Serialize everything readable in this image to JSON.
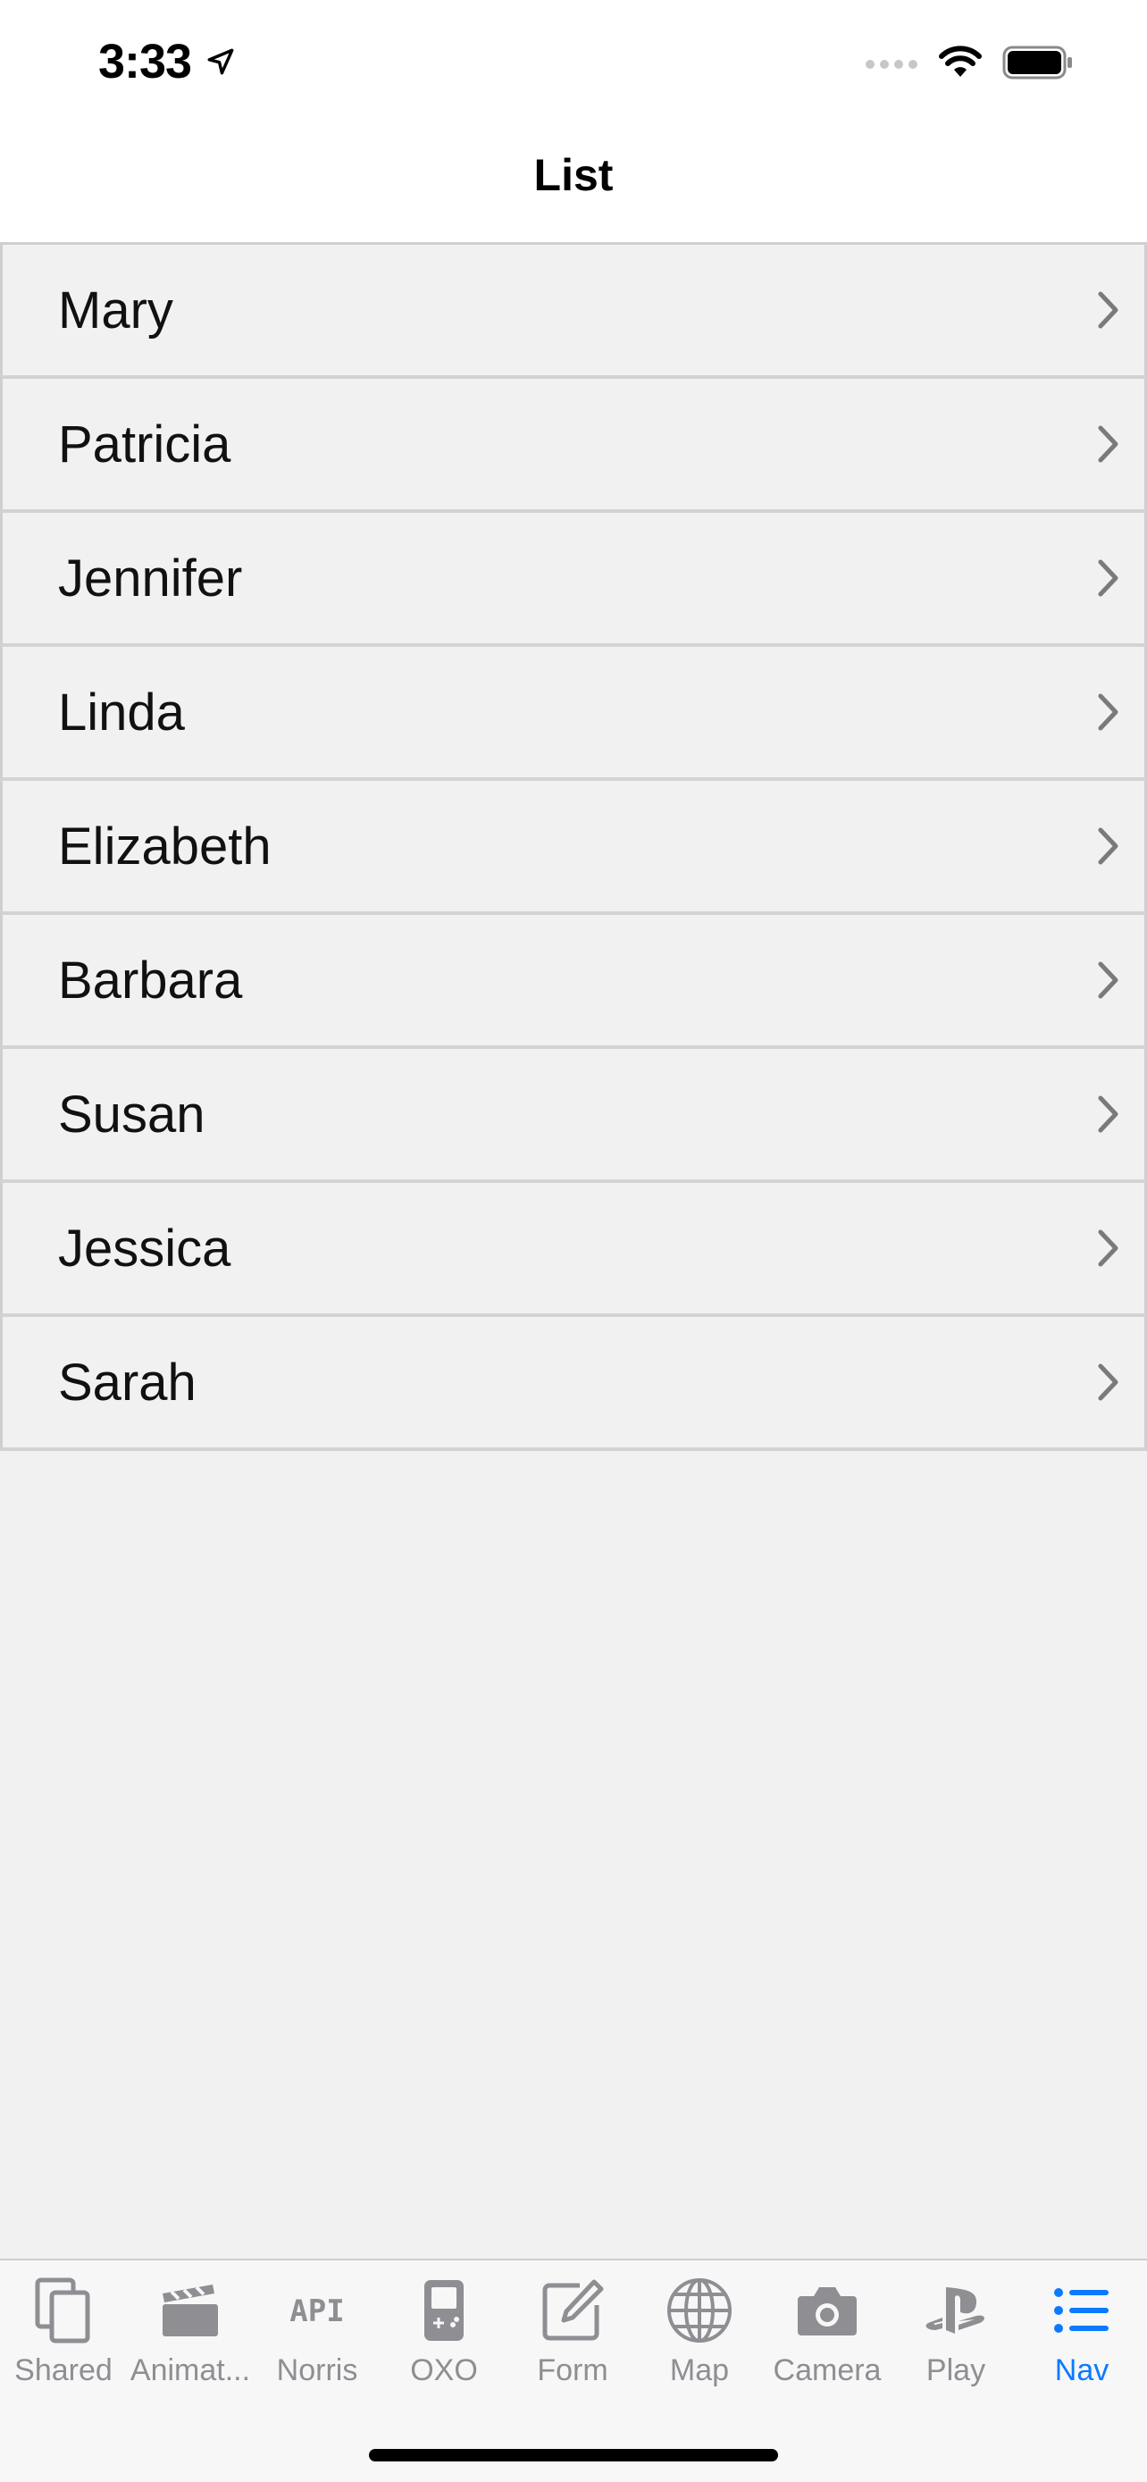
{
  "status_bar": {
    "time": "3:33",
    "icons": [
      "location-arrow-icon",
      "signal-icon",
      "wifi-icon",
      "battery-icon"
    ]
  },
  "nav": {
    "title": "List"
  },
  "list": {
    "items": [
      {
        "label": "Mary"
      },
      {
        "label": "Patricia"
      },
      {
        "label": "Jennifer"
      },
      {
        "label": "Linda"
      },
      {
        "label": "Elizabeth"
      },
      {
        "label": "Barbara"
      },
      {
        "label": "Susan"
      },
      {
        "label": "Jessica"
      },
      {
        "label": "Sarah"
      }
    ],
    "accessory_icon": "chevron-right-icon"
  },
  "tab_bar": {
    "tabs": [
      {
        "label": "Shared",
        "icon": "copy-icon",
        "active": false
      },
      {
        "label": "Animat...",
        "icon": "clapperboard-icon",
        "active": false
      },
      {
        "label": "Norris",
        "icon": "api-icon",
        "active": false
      },
      {
        "label": "OXO",
        "icon": "gameboy-icon",
        "active": false
      },
      {
        "label": "Form",
        "icon": "pencil-square-icon",
        "active": false
      },
      {
        "label": "Map",
        "icon": "globe-icon",
        "active": false
      },
      {
        "label": "Camera",
        "icon": "camera-icon",
        "active": false
      },
      {
        "label": "Play",
        "icon": "playstation-icon",
        "active": false
      },
      {
        "label": "Nav",
        "icon": "list-bullet-icon",
        "active": true
      }
    ]
  },
  "colors": {
    "accent": "#0a7aff",
    "inactive_tab": "#8e8e93",
    "background": "#f1f1f1",
    "separator": "#cfcfcf"
  }
}
